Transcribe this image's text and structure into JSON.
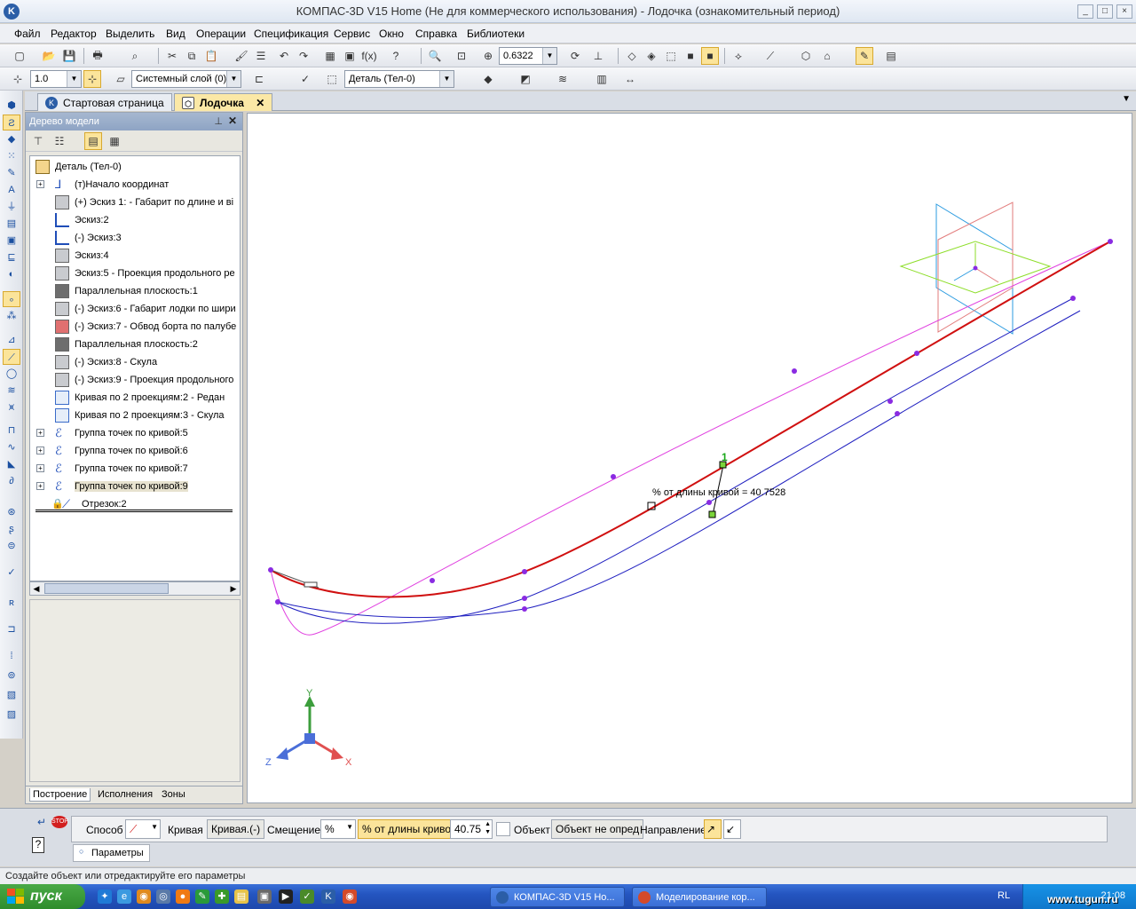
{
  "window": {
    "title": "КОМПАС-3D V15 Home (Не для коммерческого использования) - Лодочка (ознакомительный период)",
    "app_icon": "K",
    "controls": [
      "_",
      "□",
      "×"
    ]
  },
  "menu": [
    "Файл",
    "Редактор",
    "Выделить",
    "Вид",
    "Операции",
    "Спецификация",
    "Сервис",
    "Окно",
    "Справка",
    "Библиотеки"
  ],
  "toolbar1": {
    "zoom_value": "0.6322",
    "fx_label": "f(x)"
  },
  "toolbar2": {
    "step_value": "1.0",
    "layer_value": "Системный слой (0)",
    "part_value": "Деталь (Тел-0)"
  },
  "doc_tabs": [
    {
      "label": "Стартовая страница",
      "active": false
    },
    {
      "label": "Лодочка",
      "active": true
    }
  ],
  "tree_panel": {
    "title": "Дерево модели",
    "root": "Деталь (Тел-0)",
    "items": [
      {
        "label": "(т)Начало координат",
        "expand": "+",
        "icon": "axis"
      },
      {
        "label": "(+) Эскиз 1: - Габарит по длине и ві",
        "icon": "sketch-gray"
      },
      {
        "label": "Эскиз:2",
        "icon": "sketch-blue"
      },
      {
        "label": "(-) Эскиз:3",
        "icon": "sketch-blue"
      },
      {
        "label": "Эскиз:4",
        "icon": "sketch-gray"
      },
      {
        "label": "Эскиз:5 - Проекция продольного ре",
        "icon": "sketch-gray"
      },
      {
        "label": "Параллельная плоскость:1",
        "icon": "plane"
      },
      {
        "label": "(-) Эскиз:6 - Габарит лодки по шири",
        "icon": "sketch-gray"
      },
      {
        "label": "(-) Эскиз:7 - Обвод борта по палубе",
        "icon": "sketch-red"
      },
      {
        "label": "Параллельная плоскость:2",
        "icon": "plane"
      },
      {
        "label": "(-) Эскиз:8 - Скула",
        "icon": "sketch-gray"
      },
      {
        "label": "(-) Эскиз:9 - Проекция продольного",
        "icon": "sketch-gray"
      },
      {
        "label": "Кривая по 2 проекциям:2 - Редан",
        "icon": "curve"
      },
      {
        "label": "Кривая по 2 проекциям:3 - Скула",
        "icon": "curve"
      },
      {
        "label": "Группа точек по кривой:5",
        "expand": "+",
        "icon": "points"
      },
      {
        "label": "Группа точек по кривой:6",
        "expand": "+",
        "icon": "points"
      },
      {
        "label": "Группа точек по кривой:7",
        "expand": "+",
        "icon": "points"
      },
      {
        "label": "Группа точек по кривой:9",
        "expand": "+",
        "icon": "points",
        "highlight": true
      },
      {
        "label": "Отрезок:2",
        "icon": "segment"
      }
    ],
    "bottom_tabs": [
      "Построение",
      "Исполнения",
      "Зоны"
    ]
  },
  "viewport": {
    "annotation": "% от длины кривой = 40.7528",
    "point_label": "1",
    "axes": {
      "x": "X",
      "y": "Y",
      "z": "Z"
    }
  },
  "params": {
    "method_label": "Способ",
    "curve_label": "Кривая",
    "curve_value": "Кривая.(-)",
    "offset_label": "Смещение",
    "percent_label": "% от длины кривой",
    "percent_value": "40.75",
    "object_label": "Объект",
    "object_value": "Объект не опред",
    "direction_label": "Направление",
    "tab_label": "Параметры"
  },
  "status": "Создайте объект или отредактируйте его параметры",
  "taskbar": {
    "start": "пуск",
    "tasks": [
      "КОМПАС-3D V15 Ho...",
      "Моделирование кор..."
    ],
    "lang": "RL",
    "clock": "21:08",
    "watermark": "www.tugun.ru"
  }
}
